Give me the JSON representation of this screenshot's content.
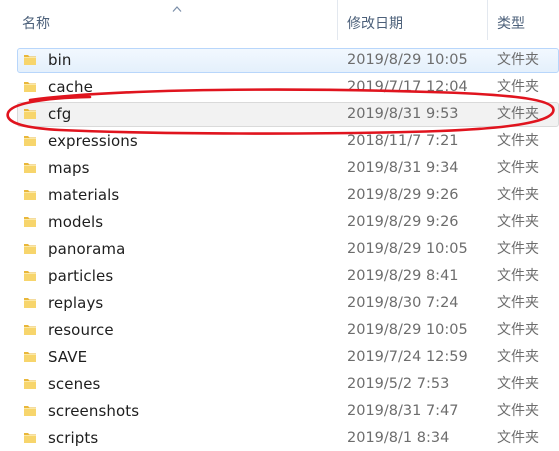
{
  "header": {
    "name_label": "名称",
    "date_label": "修改日期",
    "type_label": "类型"
  },
  "colors": {
    "header_text": "#4c607a",
    "selected_bg": "#e4f0fc",
    "selected_border": "#b8d6fb",
    "folder": "#f2c94c",
    "annotation": "#e0141e"
  },
  "files": [
    {
      "name": "bin",
      "date": "2019/8/29 10:05",
      "type": "文件夹",
      "icon": "folder-icon",
      "state": "selected"
    },
    {
      "name": "cache",
      "date": "2019/7/17 12:04",
      "type": "文件夹",
      "icon": "folder-icon",
      "state": ""
    },
    {
      "name": "cfg",
      "date": "2019/8/31 9:53",
      "type": "文件夹",
      "icon": "folder-icon",
      "state": "highlight"
    },
    {
      "name": "expressions",
      "date": "2018/11/7 7:21",
      "type": "文件夹",
      "icon": "folder-icon",
      "state": ""
    },
    {
      "name": "maps",
      "date": "2019/8/31 9:34",
      "type": "文件夹",
      "icon": "folder-icon",
      "state": ""
    },
    {
      "name": "materials",
      "date": "2019/8/29 9:26",
      "type": "文件夹",
      "icon": "folder-icon",
      "state": ""
    },
    {
      "name": "models",
      "date": "2019/8/29 9:26",
      "type": "文件夹",
      "icon": "folder-icon",
      "state": ""
    },
    {
      "name": "panorama",
      "date": "2019/8/29 10:05",
      "type": "文件夹",
      "icon": "folder-icon",
      "state": ""
    },
    {
      "name": "particles",
      "date": "2019/8/29 8:41",
      "type": "文件夹",
      "icon": "folder-icon",
      "state": ""
    },
    {
      "name": "replays",
      "date": "2019/8/30 7:24",
      "type": "文件夹",
      "icon": "folder-icon",
      "state": ""
    },
    {
      "name": "resource",
      "date": "2019/8/29 10:05",
      "type": "文件夹",
      "icon": "folder-icon",
      "state": ""
    },
    {
      "name": "SAVE",
      "date": "2019/7/24 12:59",
      "type": "文件夹",
      "icon": "folder-icon",
      "state": ""
    },
    {
      "name": "scenes",
      "date": "2019/5/2 7:53",
      "type": "文件夹",
      "icon": "folder-icon",
      "state": ""
    },
    {
      "name": "screenshots",
      "date": "2019/8/31 7:47",
      "type": "文件夹",
      "icon": "folder-icon",
      "state": ""
    },
    {
      "name": "scripts",
      "date": "2019/8/1 8:34",
      "type": "文件夹",
      "icon": "folder-icon",
      "state": ""
    }
  ]
}
